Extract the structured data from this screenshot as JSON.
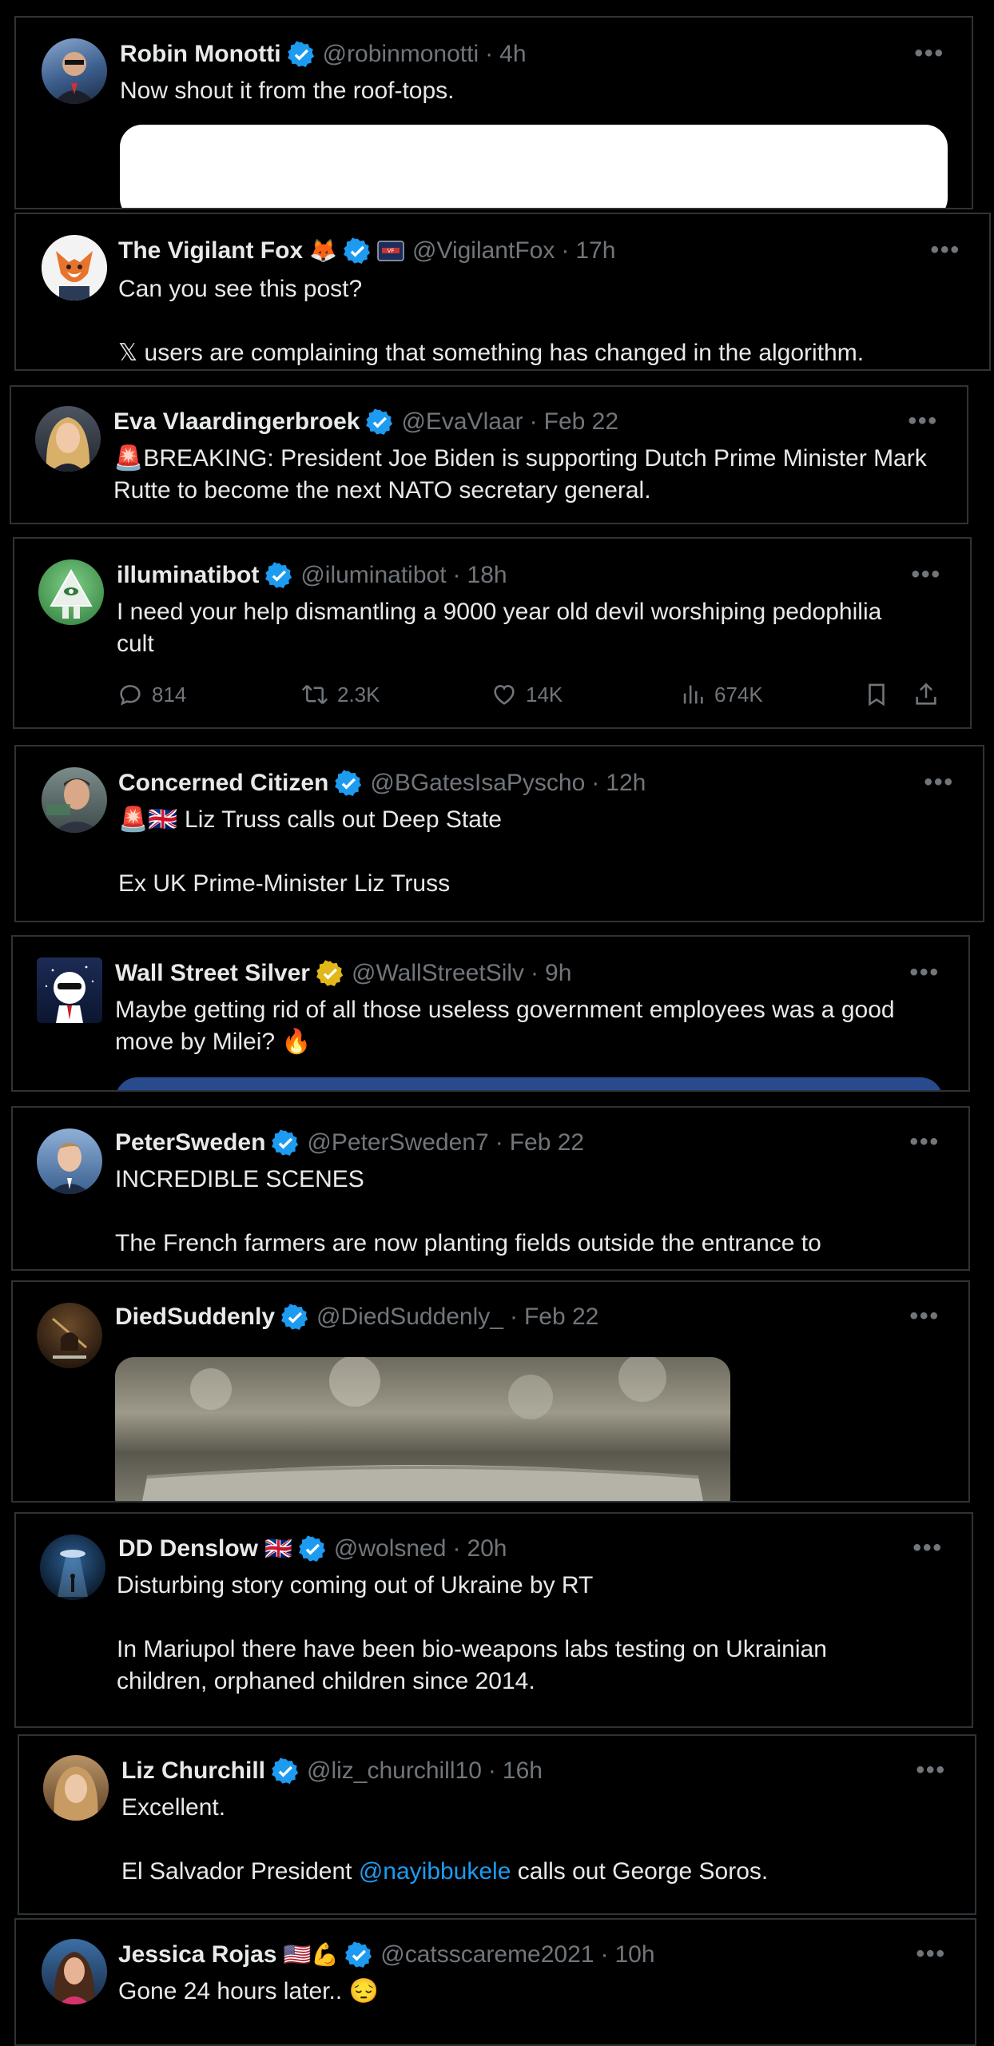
{
  "posts": [
    {
      "name": "Robin Monotti",
      "handle": "@robinmonotti",
      "time": "4h",
      "lines": [
        "Now shout it from the roof-tops."
      ]
    },
    {
      "name": "The Vigilant Fox",
      "handle": "@VigilantFox",
      "time": "17h",
      "lines": [
        "Can you see this post?",
        "",
        "𝕏 users are complaining that something has changed in the algorithm."
      ]
    },
    {
      "name": "Eva Vlaardingerbroek",
      "handle": "@EvaVlaar",
      "time": "Feb 22",
      "lines": [
        "🚨BREAKING: President Joe Biden is supporting Dutch Prime Minister Mark",
        "Rutte to become the next NATO secretary general."
      ]
    },
    {
      "name": "illuminatibot",
      "handle": "@iluminatibot",
      "time": "18h",
      "lines": [
        "I need your help dismantling a 9000 year old devil worshiping pedophilia",
        "cult"
      ],
      "stats": {
        "replies": "814",
        "reposts": "2.3K",
        "likes": "14K",
        "views": "674K"
      }
    },
    {
      "name": "Concerned Citizen",
      "handle": "@BGatesIsaPyscho",
      "time": "12h",
      "lines": [
        "🚨🇬🇧 Liz Truss calls out Deep State",
        "",
        "Ex UK Prime-Minister Liz Truss"
      ]
    },
    {
      "name": "Wall Street Silver",
      "handle": "@WallStreetSilv",
      "time": "9h",
      "lines": [
        "Maybe getting rid of all those useless government employees was a good",
        "move by Milei? 🔥"
      ]
    },
    {
      "name": "PeterSweden",
      "handle": "@PeterSweden7",
      "time": "Feb 22",
      "lines": [
        "INCREDIBLE SCENES",
        "",
        "The French farmers are now planting fields outside the entrance to"
      ]
    },
    {
      "name": "DiedSuddenly",
      "handle": "@DiedSuddenly_",
      "time": "Feb 22",
      "lines": []
    },
    {
      "name": "DD Denslow",
      "handle": "@wolsned",
      "time": "20h",
      "lines": [
        "Disturbing story coming out of Ukraine by RT",
        "",
        "In Mariupol there have been bio-weapons labs testing on Ukrainian",
        "children, orphaned children since 2014."
      ]
    },
    {
      "name": "Liz Churchill",
      "handle": "@liz_churchill10",
      "time": "16h",
      "lines": [
        "Excellent.",
        ""
      ],
      "line3_pre": "El Salvador President ",
      "line3_link": "@nayibbukele",
      "line3_post": " calls out George Soros."
    },
    {
      "name": "Jessica Rojas",
      "handle": "@catsscareme2021",
      "time": "10h",
      "lines": [
        "Gone 24 hours later.. 😔"
      ]
    }
  ],
  "avatar_desc": [
    "robin-avatar",
    "fox-avatar",
    "eva-avatar",
    "pyramid-avatar",
    "citizen-avatar",
    "silver-avatar",
    "peter-avatar",
    "died-avatar",
    "dd-avatar",
    "liz-avatar",
    "jessica-avatar"
  ],
  "accent": "#1d9bf0",
  "more_label": "•••",
  "dot": "·",
  "emoji_fox": "🦊",
  "emoji_flag_gb": "🇬🇧",
  "emoji_flag_us": "🇺🇸",
  "emoji_muscle": "💪"
}
